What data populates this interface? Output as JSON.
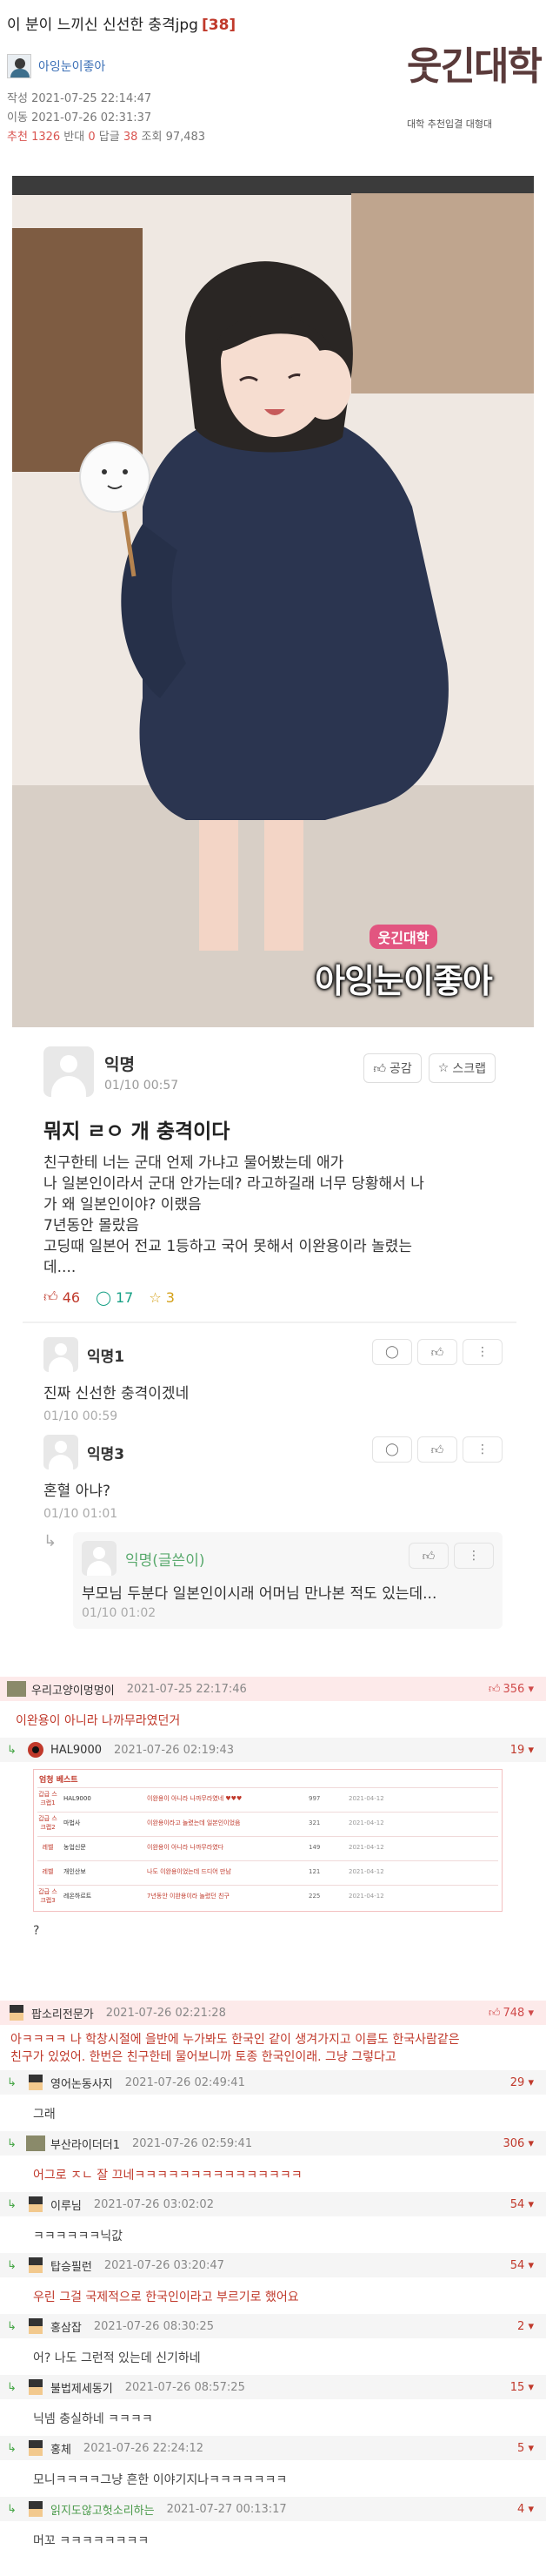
{
  "post": {
    "title": "이 분이 느끼신 신선한 충격jpg",
    "comment_count": "[38]",
    "author": "아잉눈이좋아",
    "created_label": "작성",
    "created": "2021-07-25 22:14:47",
    "moved_label": "이동",
    "moved": "2021-07-26 02:31:37",
    "stats_rec_label": "추천",
    "stats_rec": "1326",
    "stats_opp_label": "반대",
    "stats_opp": "0",
    "stats_cmt_label": "답글",
    "stats_cmt": "38",
    "stats_view_label": "조회",
    "stats_view": "97,483"
  },
  "logo": {
    "name": "웃긴대학",
    "slogan": "대학 추천입결 대형대"
  },
  "comic": {
    "caption_small": "웃긴대학",
    "caption_big": "아잉눈이좋아"
  },
  "embed": {
    "author": "익명",
    "date": "01/10 00:57",
    "like_label": "공감",
    "scrap_label": "스크랩",
    "title": "뭐지 ㄹㅇ 개 충격이다",
    "body": [
      "친구한테 너는 군대 언제 가냐고 물어봤는데 애가",
      "나 일본인이라서 군대 안가는데? 라고하길래 너무 당황해서 나",
      "가 왜 일본인이야? 이랬음",
      "7년동안 몰랐음",
      "고딩때 일본어 전교 1등하고 국어 못해서 이완용이라 놀렸는",
      "데...."
    ],
    "likes": "46",
    "comments": "17",
    "scraps": "3",
    "comments_list": [
      {
        "name": "익명1",
        "body": "진짜 신선한 충격이겠네",
        "date": "01/10 00:59"
      },
      {
        "name": "익명3",
        "body": "혼혈 아냐?",
        "date": "01/10 01:01"
      }
    ],
    "reply": {
      "name": "익명(글쓴이)",
      "body": "부모님 두분다 일본인이시래 어머님 만나본 적도 있는데...",
      "date": "01/10 01:02"
    }
  },
  "ranking": {
    "title": "엄청 베스트",
    "rows": [
      {
        "rank": "갑급 스크랩1",
        "title": "이완용이 아니라 나까무라였네 ♥♥♥",
        "nick": "HAL9000",
        "views": "997",
        "date": "2021-04-12"
      },
      {
        "rank": "갑급 스크랩2",
        "title": "이완용이라고 놀렸는데 일본인이었음",
        "nick": "마법사",
        "views": "321",
        "date": "2021-04-12"
      },
      {
        "rank": "레벨",
        "title": "이완용이 아니라 나까무라였다",
        "nick": "농업신문",
        "views": "149",
        "date": "2021-04-12"
      },
      {
        "rank": "레벨",
        "title": "나도 이완용이었는데 드디어 만남",
        "nick": "개인산보",
        "views": "121",
        "date": "2021-04-12"
      },
      {
        "rank": "갑급 스크랩3",
        "title": "7년동안 이완용이라 놀렸던 친구",
        "nick": "레온하르트",
        "views": "225",
        "date": "2021-04-12"
      }
    ]
  },
  "comments": [
    {
      "type": "best",
      "name": "우리고양이멍멍이",
      "date": "2021-07-25 22:17:46",
      "score": "356",
      "body": "이완용이 아니라 나까무라였던거"
    },
    {
      "type": "reply",
      "name": "HAL9000",
      "date": "2021-07-26 02:19:43",
      "score": "19",
      "body": "?"
    },
    {
      "type": "best",
      "name": "팝소리전문가",
      "date": "2021-07-26 02:21:28",
      "score": "748",
      "body": "아ㅋㅋㅋㅋ 나 학창시절에 을반에 누가봐도 한국인 같이 생겨가지고 이름도 한국사람같은",
      "body2": "친구가 있었어. 한번은 친구한테 물어보니까 토종 한국인이래. 그냥 그렇다고"
    },
    {
      "type": "reply",
      "name": "영어논동사지",
      "date": "2021-07-26 02:49:41",
      "score": "29",
      "body": "그래"
    },
    {
      "type": "reply",
      "name": "부산라이더더1",
      "date": "2021-07-26 02:59:41",
      "score": "306",
      "body": "어그로 ㅈㄴ 잘 끄네ㅋㅋㅋㅋㅋㅋㅋㅋㅋㅋㅋㅋㅋㅋㅋ"
    },
    {
      "type": "reply",
      "name": "이루님",
      "date": "2021-07-26 03:02:02",
      "score": "54",
      "body": "ㅋㅋㅋㅋㅋㅋ닉값"
    },
    {
      "type": "reply",
      "name": "탑승필런",
      "date": "2021-07-26 03:20:47",
      "score": "54",
      "body": "우린 그걸 국제적으로 한국인이라고 부르기로 했어요"
    },
    {
      "type": "reply",
      "name": "홍삼잡",
      "date": "2021-07-26 08:30:25",
      "score": "2",
      "body": "어? 나도 그런적 있는데 신기하네"
    },
    {
      "type": "reply",
      "name": "불법제세동기",
      "date": "2021-07-26 08:57:25",
      "score": "15",
      "body": "닉넴 충실하네 ㅋㅋㅋㅋ"
    },
    {
      "type": "reply",
      "name": "홍체",
      "date": "2021-07-26 22:24:12",
      "score": "5",
      "body": "모니ㅋㅋㅋㅋ그냥 흔한 이야기지나ㅋㅋㅋㅋㅋㅋㅋ"
    },
    {
      "type": "reply",
      "name": "읽지도않고헛소리하는",
      "date": "2021-07-27 00:13:17",
      "score": "4",
      "body": "머꼬 ㅋㅋㅋㅋㅋㅋㅋㅋ"
    }
  ]
}
